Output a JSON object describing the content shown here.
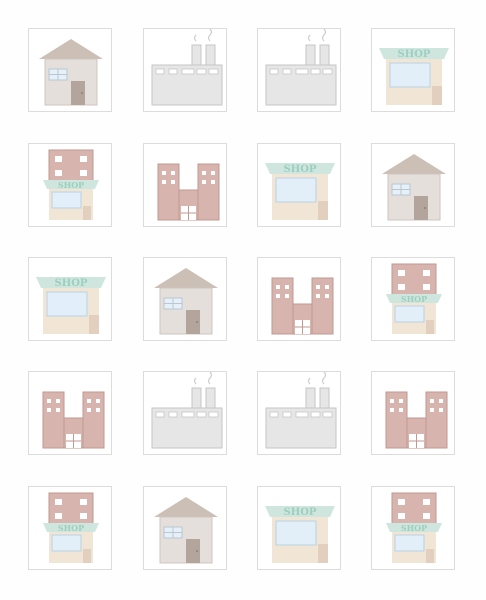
{
  "board": {
    "columns": 4,
    "rows": 5,
    "tiles": [
      {
        "type": "house"
      },
      {
        "type": "factory"
      },
      {
        "type": "factory"
      },
      {
        "type": "shop"
      },
      {
        "type": "store"
      },
      {
        "type": "office"
      },
      {
        "type": "shop"
      },
      {
        "type": "house"
      },
      {
        "type": "shop"
      },
      {
        "type": "house"
      },
      {
        "type": "office"
      },
      {
        "type": "store"
      },
      {
        "type": "office"
      },
      {
        "type": "factory"
      },
      {
        "type": "factory"
      },
      {
        "type": "office"
      },
      {
        "type": "store"
      },
      {
        "type": "house"
      },
      {
        "type": "shop"
      },
      {
        "type": "store"
      }
    ]
  },
  "sign_text": "SHOP",
  "colors": {
    "tile_border": "#dcdcdc",
    "house_roof": "#cbbfb6",
    "house_wall": "#e4dfda",
    "house_door": "#b3a59c",
    "window": "#e7f0f8",
    "factory_body": "#e6e6e6",
    "factory_outline": "#c6c6c6",
    "chimney": "#e6e6e6",
    "smoke": "#cfcfcf",
    "shop_awning": "#cfe6df",
    "shop_text": "#9ccfbf",
    "shop_wall": "#f1e5d6",
    "shop_door": "#e2cfbd",
    "shop_window": "#e3eff8",
    "brick": "#d7b4ae",
    "brick_outline": "#bf9a93"
  }
}
